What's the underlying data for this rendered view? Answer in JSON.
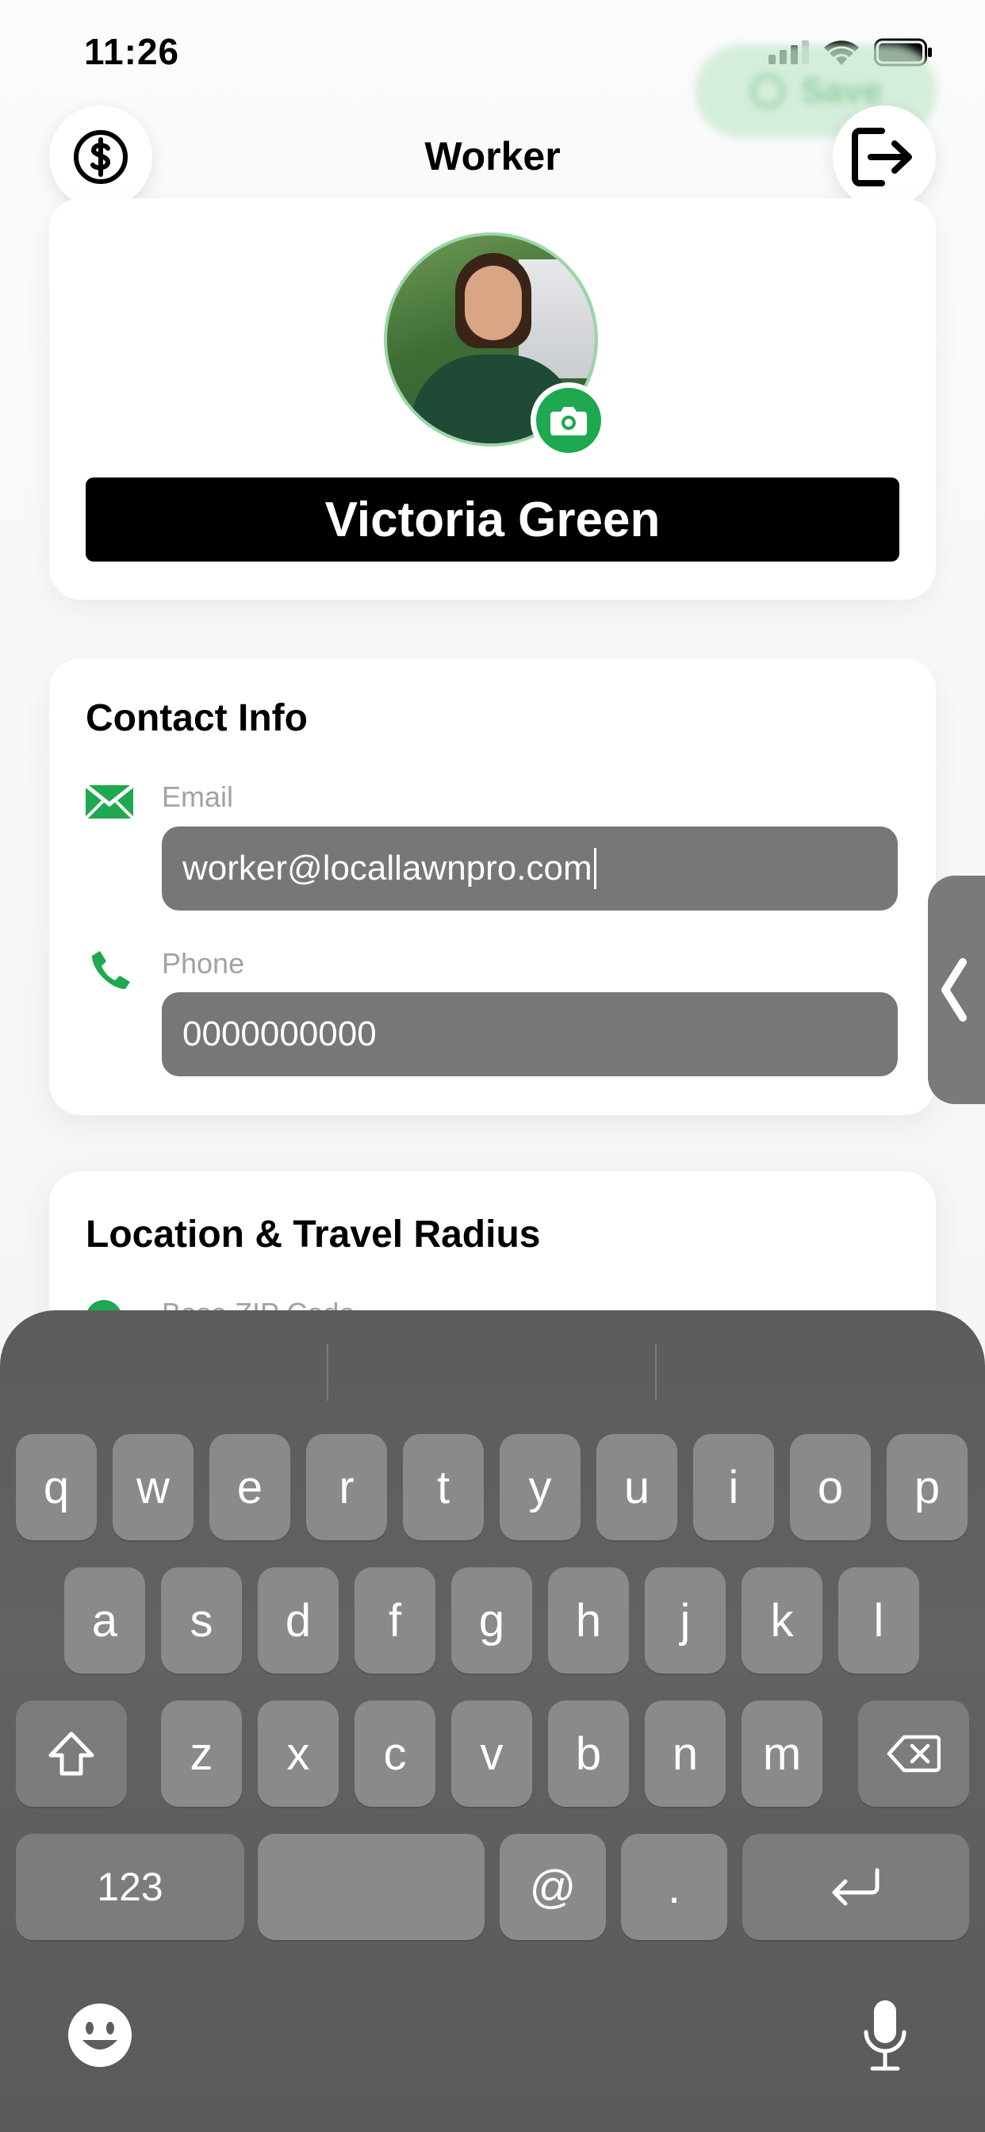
{
  "status_bar": {
    "time": "11:26"
  },
  "header": {
    "title": "Worker",
    "save_label": "Save"
  },
  "profile": {
    "name": "Victoria Green"
  },
  "contact": {
    "title": "Contact Info",
    "email_label": "Email",
    "email_value": "worker@locallawnpro.com",
    "phone_label": "Phone",
    "phone_value": "0000000000"
  },
  "location": {
    "title": "Location & Travel Radius",
    "zip_label": "Base ZIP Code"
  },
  "keyboard": {
    "row1": [
      "q",
      "w",
      "e",
      "r",
      "t",
      "y",
      "u",
      "i",
      "o",
      "p"
    ],
    "row2": [
      "a",
      "s",
      "d",
      "f",
      "g",
      "h",
      "j",
      "k",
      "l"
    ],
    "row3": [
      "z",
      "x",
      "c",
      "v",
      "b",
      "n",
      "m"
    ],
    "numbers_key": "123",
    "at_key": "@",
    "dot_key": "."
  },
  "colors": {
    "accent_green": "#1ea84f",
    "input_bg": "#77777a",
    "keyboard_bg": "#5e5e5e"
  }
}
